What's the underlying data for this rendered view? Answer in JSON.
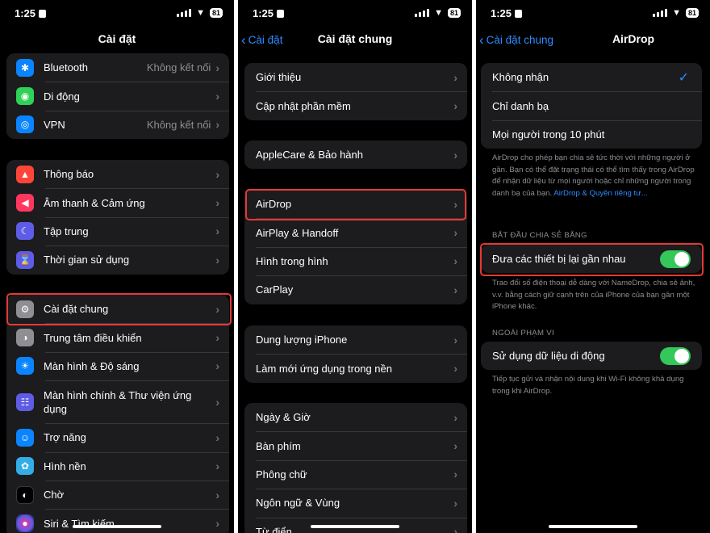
{
  "status": {
    "time": "1:25",
    "battery": "81"
  },
  "panel1": {
    "title": "Cài đặt",
    "group1": [
      {
        "label": "Bluetooth",
        "value": "Không kết nối",
        "icon": "bluetooth-icon",
        "color": "#0a84ff"
      },
      {
        "label": "Di động",
        "value": "",
        "icon": "cellular-icon",
        "color": "#30d158"
      },
      {
        "label": "VPN",
        "value": "Không kết nối",
        "icon": "vpn-globe-icon",
        "color": "#0a84ff"
      }
    ],
    "group2": [
      {
        "label": "Thông báo",
        "icon": "notifications-bell-icon",
        "color": "#ff453a"
      },
      {
        "label": "Âm thanh & Cảm ứng",
        "icon": "sound-speaker-icon",
        "color": "#ff375f"
      },
      {
        "label": "Tập trung",
        "icon": "focus-moon-icon",
        "color": "#5e5ce6"
      },
      {
        "label": "Thời gian sử dụng",
        "icon": "screen-time-hourglass-icon",
        "color": "#5e5ce6"
      }
    ],
    "group3": [
      {
        "label": "Cài đặt chung",
        "icon": "general-gear-icon",
        "color": "#8e8e93"
      },
      {
        "label": "Trung tâm điều khiển",
        "icon": "control-center-icon",
        "color": "#8e8e93"
      },
      {
        "label": "Màn hình & Độ sáng",
        "icon": "brightness-sun-icon",
        "color": "#0a84ff"
      },
      {
        "label": "Màn hình chính & Thư viện ứng dụng",
        "icon": "home-screen-grid-icon",
        "color": "#5e5ce6"
      },
      {
        "label": "Trợ năng",
        "icon": "accessibility-icon",
        "color": "#0a84ff"
      },
      {
        "label": "Hình nền",
        "icon": "wallpaper-flower-icon",
        "color": "#32ade6"
      },
      {
        "label": "Chờ",
        "icon": "standby-icon",
        "color": "#1c1c1e"
      },
      {
        "label": "Siri & Tìm kiếm",
        "icon": "siri-icon",
        "color": "#2c2c2e"
      }
    ]
  },
  "panel2": {
    "back": "Cài đặt",
    "title": "Cài đặt chung",
    "group1": [
      "Giới thiệu",
      "Cập nhật phần mềm"
    ],
    "group2": [
      "AppleCare & Bảo hành"
    ],
    "group3": [
      "AirDrop",
      "AirPlay & Handoff",
      "Hình trong hình",
      "CarPlay"
    ],
    "group4": [
      "Dung lượng iPhone",
      "Làm mới ứng dụng trong nền"
    ],
    "group5": [
      "Ngày & Giờ",
      "Bàn phím",
      "Phông chữ",
      "Ngôn ngữ & Vùng",
      "Từ điển"
    ]
  },
  "panel3": {
    "back": "Cài đặt chung",
    "title": "AirDrop",
    "options": [
      "Không nhận",
      "Chỉ danh bạ",
      "Mọi người trong 10 phút"
    ],
    "selected": "Không nhận",
    "note1": "AirDrop cho phép bạn chia sẻ tức thời với những người ở gần. Bạn có thể đặt trạng thái có thể tìm thấy trong AirDrop để nhận dữ liệu từ mọi người hoặc chỉ những người trong danh bạ của bạn.",
    "note1_link": "AirDrop & Quyền riêng tư...",
    "section1": "BẮT ĐẦU CHIA SẺ BẰNG",
    "toggle1": {
      "label": "Đưa các thiết bị lại gần nhau",
      "on": true
    },
    "note2": "Trao đổi số điện thoại dễ dàng với NameDrop, chia sẻ ảnh, v.v. bằng cách giữ cạnh trên của iPhone của bạn gần một iPhone khác.",
    "section2": "NGOÀI PHẠM VI",
    "toggle2": {
      "label": "Sử dụng dữ liệu di động",
      "on": true
    },
    "note3": "Tiếp tục gửi và nhận nội dung khi Wi-Fi không khả dụng trong khi AirDrop."
  },
  "colors": {
    "highlight": "#e53935",
    "accent": "#2f8cff",
    "toggle": "#34c759"
  }
}
